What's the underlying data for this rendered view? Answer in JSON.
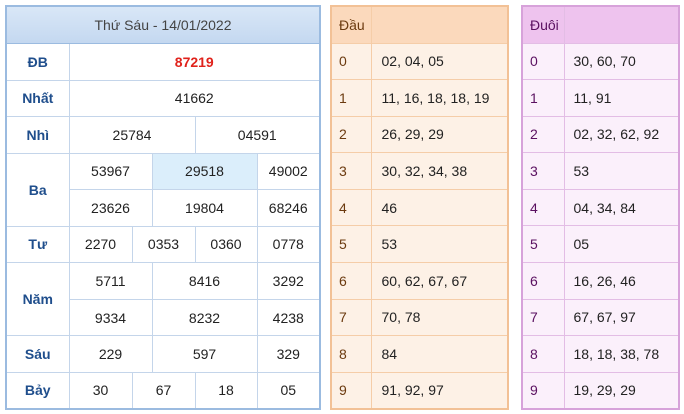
{
  "results": {
    "title": "Thứ Sáu - 14/01/2022",
    "special": {
      "label": "ĐB",
      "value": "87219"
    },
    "first": {
      "label": "Nhất",
      "value": "41662"
    },
    "second": {
      "label": "Nhì",
      "values": [
        "25784",
        "04591"
      ]
    },
    "third": {
      "label": "Ba",
      "values": [
        "53967",
        "29518",
        "49002",
        "23626",
        "19804",
        "68246"
      ]
    },
    "fourth": {
      "label": "Tư",
      "values": [
        "2270",
        "0353",
        "0360",
        "0778"
      ]
    },
    "fifth": {
      "label": "Năm",
      "values": [
        "5711",
        "8416",
        "3292",
        "9334",
        "8232",
        "4238"
      ]
    },
    "sixth": {
      "label": "Sáu",
      "values": [
        "229",
        "597",
        "329"
      ]
    },
    "seventh": {
      "label": "Bảy",
      "values": [
        "30",
        "67",
        "18",
        "05"
      ]
    }
  },
  "head": {
    "header": "Đầu",
    "rows": [
      {
        "k": "0",
        "v": "02, 04, 05"
      },
      {
        "k": "1",
        "v": "11, 16, 18, 18, 19"
      },
      {
        "k": "2",
        "v": "26, 29, 29"
      },
      {
        "k": "3",
        "v": "30, 32, 34, 38"
      },
      {
        "k": "4",
        "v": "46"
      },
      {
        "k": "5",
        "v": "53"
      },
      {
        "k": "6",
        "v": "60, 62, 67, 67"
      },
      {
        "k": "7",
        "v": "70, 78"
      },
      {
        "k": "8",
        "v": "84"
      },
      {
        "k": "9",
        "v": "91, 92, 97"
      }
    ]
  },
  "tail": {
    "header": "Đuôi",
    "rows": [
      {
        "k": "0",
        "v": "30, 60, 70"
      },
      {
        "k": "1",
        "v": "11, 91"
      },
      {
        "k": "2",
        "v": "02, 32, 62, 92"
      },
      {
        "k": "3",
        "v": "53"
      },
      {
        "k": "4",
        "v": "04, 34, 84"
      },
      {
        "k": "5",
        "v": "05"
      },
      {
        "k": "6",
        "v": "16, 26, 46"
      },
      {
        "k": "7",
        "v": "67, 67, 97"
      },
      {
        "k": "8",
        "v": "18, 18, 38, 78"
      },
      {
        "k": "9",
        "v": "19, 29, 29"
      }
    ]
  },
  "colors": {
    "special": "#e0221b",
    "label": "#1f4e8c",
    "highlight": "#dbeefb"
  }
}
